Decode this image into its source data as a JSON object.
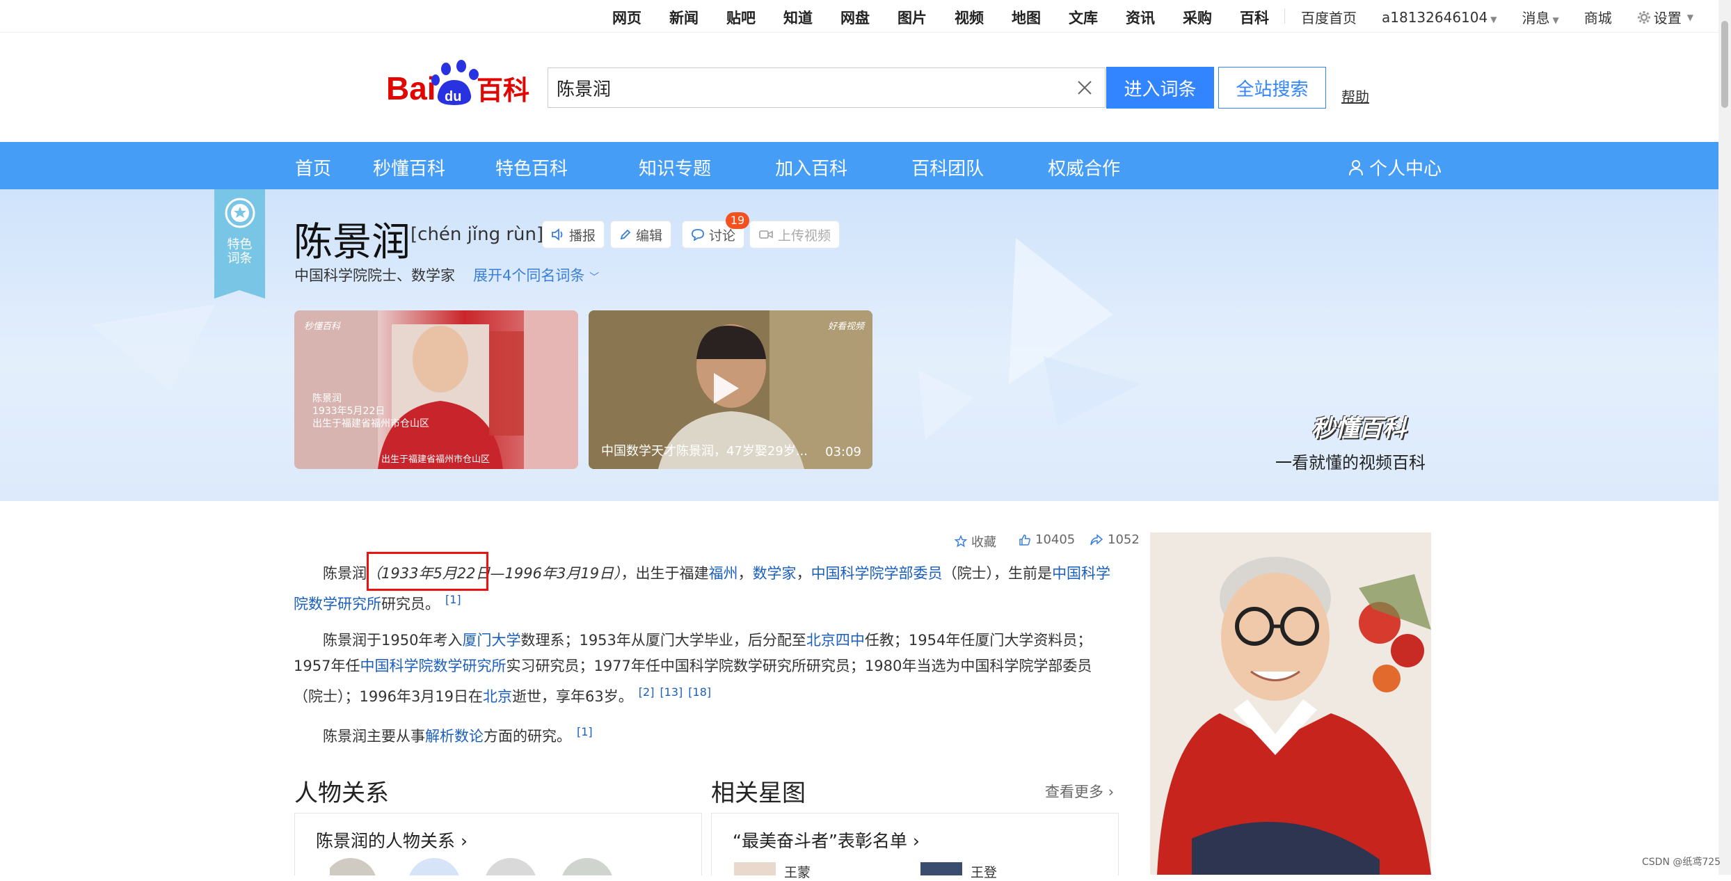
{
  "topnav": {
    "links": [
      "网页",
      "新闻",
      "贴吧",
      "知道",
      "网盘",
      "图片",
      "视频",
      "地图",
      "文库",
      "资讯",
      "采购",
      "百科"
    ],
    "right": {
      "home": "百度首页",
      "user": "a18132646104",
      "messages": "消息",
      "mall": "商城",
      "settings": "设置"
    }
  },
  "header": {
    "logo_text": "Bai",
    "logo_paw": "du",
    "logo_suffix": "百科",
    "search_value": "陈景润",
    "enter_button": "进入词条",
    "site_search_button": "全站搜索",
    "help": "帮助"
  },
  "navbar": {
    "items": [
      "首页",
      "秒懂百科",
      "特色百科",
      "知识专题",
      "加入百科",
      "百科团队",
      "权威合作"
    ],
    "user_center": "个人中心"
  },
  "entry": {
    "ribbon_line1": "特色",
    "ribbon_line2": "词条",
    "title": "陈景润",
    "pinyin": "[chén jǐng rùn]",
    "actions": {
      "play": "播报",
      "edit": "编辑",
      "discuss": "讨论",
      "discuss_count": "19",
      "upload": "上传视频"
    },
    "subtitle": "中国科学院院士、数学家",
    "expand": "展开4个同名词条"
  },
  "videos": [
    {
      "logo": "秒懂百科",
      "overlay_line1": "陈景润",
      "overlay_line2": "1933年5月22日",
      "overlay_line3": "出生于福建省福州市仓山区",
      "caption": "出生于福建省福州市仓山区",
      "duration": ""
    },
    {
      "logo": "好看视频",
      "caption": "中国数学天才陈景润，47岁娶29岁...",
      "duration": "03:09"
    }
  ],
  "banner_brand": {
    "name": "秒懂百科",
    "slogan": "一看就懂的视频百科"
  },
  "stats": {
    "collect": "收藏",
    "likes": "10405",
    "shares": "1052"
  },
  "paragraphs": {
    "p1": {
      "t1": "陈景润",
      "birth": "（1933年5月22日",
      "death": "—1996年3月19日）",
      "t2": "，出生于福建",
      "l1": "福州",
      "t3": "，",
      "l2": "数学家",
      "t4": "，",
      "l3": "中国科学院学部委员",
      "t5": "（院士），生前是",
      "l4": "中国科学院数学研究所",
      "t6": "研究员。",
      "ref": "[1]"
    },
    "p2": {
      "t1": "陈景润于1950年考入",
      "l1": "厦门大学",
      "t2": "数理系；1953年从厦门大学毕业，后分配至",
      "l2": "北京四中",
      "t3": "任教；1954年任厦门大学资料员；1957年任",
      "l3": "中国科学院数学研究所",
      "t4": "实习研究员；1977年任中国科学院数学研究所研究员；1980年当选为中国科学院学部委员（院士）；1996年3月19日在",
      "l4": "北京",
      "t5": "逝世，享年63岁。",
      "r1": "[2]",
      "r2": "[13]",
      "r3": "[18]"
    },
    "p3": {
      "t1": "陈景润主要从事",
      "l1": "解析数论",
      "t2": "方面的研究。",
      "ref": "[1]"
    }
  },
  "sections": {
    "relations_title": "人物关系",
    "relations_card": "陈景润的人物关系",
    "stars_title": "相关星图",
    "stars_more": "查看更多",
    "stars_card": "“最美奋斗者”表彰名单",
    "stars_person1": "王蒙",
    "stars_person2": "王登"
  },
  "watermark": "CSDN @纸鸢725",
  "colors": {
    "nav_blue": "#459df5",
    "button_blue": "#3385ff",
    "link_blue": "#1a5fbd",
    "highlight_red": "#e11111",
    "badge_orange": "#f4511e"
  }
}
